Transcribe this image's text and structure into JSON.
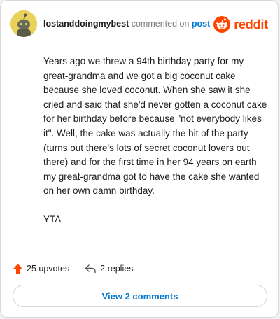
{
  "comment": {
    "username": "lostanddoingmybest",
    "action_text": "commented on",
    "post_link": "post",
    "brand_name": "reddit",
    "paragraphs": [
      "Years ago we threw a 94th birthday party for my great-grandma and we got a big coconut cake because she loved coconut. When she saw it she cried and said that she'd never gotten a coconut cake for her birthday before because \"not everybody likes it\". Well, the cake was actually the hit of the party (turns out there's lots of secret coconut lovers out there) and for the first time in her 94 years on earth my great-grandma got to have the cake she wanted on her own damn birthday.",
      "YTA"
    ],
    "upvotes_label": "25 upvotes",
    "replies_label": "2 replies",
    "view_comments_label": "View 2 comments"
  },
  "colors": {
    "brand": "#ff4500",
    "link": "#0079d3",
    "avatar_bg": "#e9d25a"
  },
  "icons": {
    "avatar": "snoo-avatar-icon",
    "brand": "reddit-logo-icon",
    "upvote": "upvote-arrow-icon",
    "reply": "reply-icon"
  }
}
